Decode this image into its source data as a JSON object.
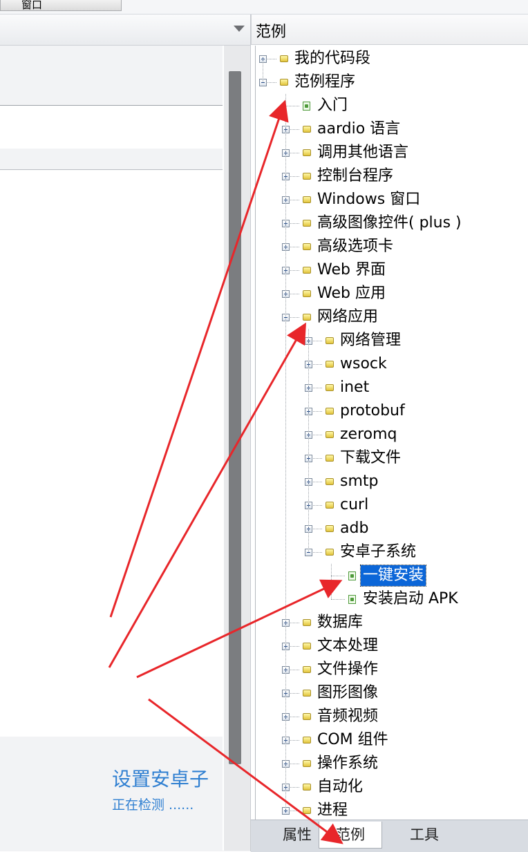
{
  "window_tab": {
    "label": "窗口"
  },
  "right_panel": {
    "title": "范例"
  },
  "tree": [
    {
      "label": "我的代码段",
      "depth": 0,
      "kind": "folder",
      "toggle": "plus"
    },
    {
      "label": "范例程序",
      "depth": 0,
      "kind": "folder",
      "toggle": "minus"
    },
    {
      "label": "入门",
      "depth": 1,
      "kind": "file",
      "toggle": "none"
    },
    {
      "label": "aardio 语言",
      "depth": 1,
      "kind": "folder",
      "toggle": "plus"
    },
    {
      "label": "调用其他语言",
      "depth": 1,
      "kind": "folder",
      "toggle": "plus"
    },
    {
      "label": "控制台程序",
      "depth": 1,
      "kind": "folder",
      "toggle": "plus"
    },
    {
      "label": "Windows 窗口",
      "depth": 1,
      "kind": "folder",
      "toggle": "plus"
    },
    {
      "label": "高级图像控件( plus )",
      "depth": 1,
      "kind": "folder",
      "toggle": "plus"
    },
    {
      "label": "高级选项卡",
      "depth": 1,
      "kind": "folder",
      "toggle": "plus"
    },
    {
      "label": "Web 界面",
      "depth": 1,
      "kind": "folder",
      "toggle": "plus"
    },
    {
      "label": "Web 应用",
      "depth": 1,
      "kind": "folder",
      "toggle": "plus"
    },
    {
      "label": "网络应用",
      "depth": 1,
      "kind": "folder",
      "toggle": "minus"
    },
    {
      "label": "网络管理",
      "depth": 2,
      "kind": "folder",
      "toggle": "plus"
    },
    {
      "label": "wsock",
      "depth": 2,
      "kind": "folder",
      "toggle": "plus"
    },
    {
      "label": "inet",
      "depth": 2,
      "kind": "folder",
      "toggle": "plus"
    },
    {
      "label": "protobuf",
      "depth": 2,
      "kind": "folder",
      "toggle": "plus"
    },
    {
      "label": "zeromq",
      "depth": 2,
      "kind": "folder",
      "toggle": "plus"
    },
    {
      "label": "下载文件",
      "depth": 2,
      "kind": "folder",
      "toggle": "plus"
    },
    {
      "label": "smtp",
      "depth": 2,
      "kind": "folder",
      "toggle": "plus"
    },
    {
      "label": "curl",
      "depth": 2,
      "kind": "folder",
      "toggle": "plus"
    },
    {
      "label": "adb",
      "depth": 2,
      "kind": "folder",
      "toggle": "plus"
    },
    {
      "label": "安卓子系统",
      "depth": 2,
      "kind": "folder",
      "toggle": "minus"
    },
    {
      "label": "一键安装",
      "depth": 3,
      "kind": "file",
      "toggle": "none",
      "selected": true
    },
    {
      "label": "安装启动 APK",
      "depth": 3,
      "kind": "file",
      "toggle": "none"
    },
    {
      "label": "数据库",
      "depth": 1,
      "kind": "folder",
      "toggle": "plus"
    },
    {
      "label": "文本处理",
      "depth": 1,
      "kind": "folder",
      "toggle": "plus"
    },
    {
      "label": "文件操作",
      "depth": 1,
      "kind": "folder",
      "toggle": "plus"
    },
    {
      "label": "图形图像",
      "depth": 1,
      "kind": "folder",
      "toggle": "plus"
    },
    {
      "label": "音频视频",
      "depth": 1,
      "kind": "folder",
      "toggle": "plus"
    },
    {
      "label": "COM 组件",
      "depth": 1,
      "kind": "folder",
      "toggle": "plus"
    },
    {
      "label": "操作系统",
      "depth": 1,
      "kind": "folder",
      "toggle": "plus"
    },
    {
      "label": "自动化",
      "depth": 1,
      "kind": "folder",
      "toggle": "plus"
    },
    {
      "label": "进程",
      "depth": 1,
      "kind": "folder",
      "toggle": "plus"
    }
  ],
  "status": {
    "title": "设置安卓子",
    "subtitle": "正在检测 ......"
  },
  "bottom_tabs": [
    {
      "label": "属性",
      "active": false
    },
    {
      "label": "范例",
      "active": true
    },
    {
      "label": "工具",
      "active": false
    }
  ],
  "colors": {
    "selection": "#0b66d8",
    "status_text": "#2f7fd1",
    "annotation_arrow": "#e8262a"
  },
  "icons": [
    "folder-icon",
    "file-icon",
    "expand-plus-icon",
    "collapse-minus-icon",
    "dropdown-arrow-icon",
    "annotation-arrow"
  ]
}
